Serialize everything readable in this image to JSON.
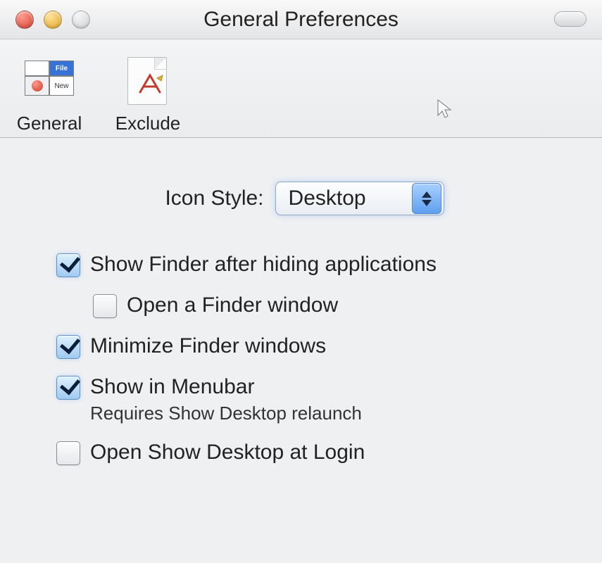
{
  "window": {
    "title": "General Preferences"
  },
  "toolbar": {
    "items": [
      {
        "id": "general",
        "label": "General",
        "selected": true
      },
      {
        "id": "exclude",
        "label": "Exclude",
        "selected": false
      }
    ]
  },
  "content": {
    "icon_style": {
      "label": "Icon Style:",
      "selected": "Desktop"
    },
    "checkboxes": {
      "show_finder": {
        "label": "Show Finder after hiding applications",
        "checked": true
      },
      "open_finder_window": {
        "label": "Open a Finder window",
        "checked": false
      },
      "minimize_finder": {
        "label": "Minimize Finder windows",
        "checked": true
      },
      "show_menubar": {
        "label": "Show in Menubar",
        "sublabel": "Requires Show Desktop relaunch",
        "checked": true
      },
      "open_at_login": {
        "label": "Open Show Desktop at Login",
        "checked": false
      }
    }
  },
  "icons": {
    "general_tile_file": "File",
    "general_tile_new": "New"
  }
}
